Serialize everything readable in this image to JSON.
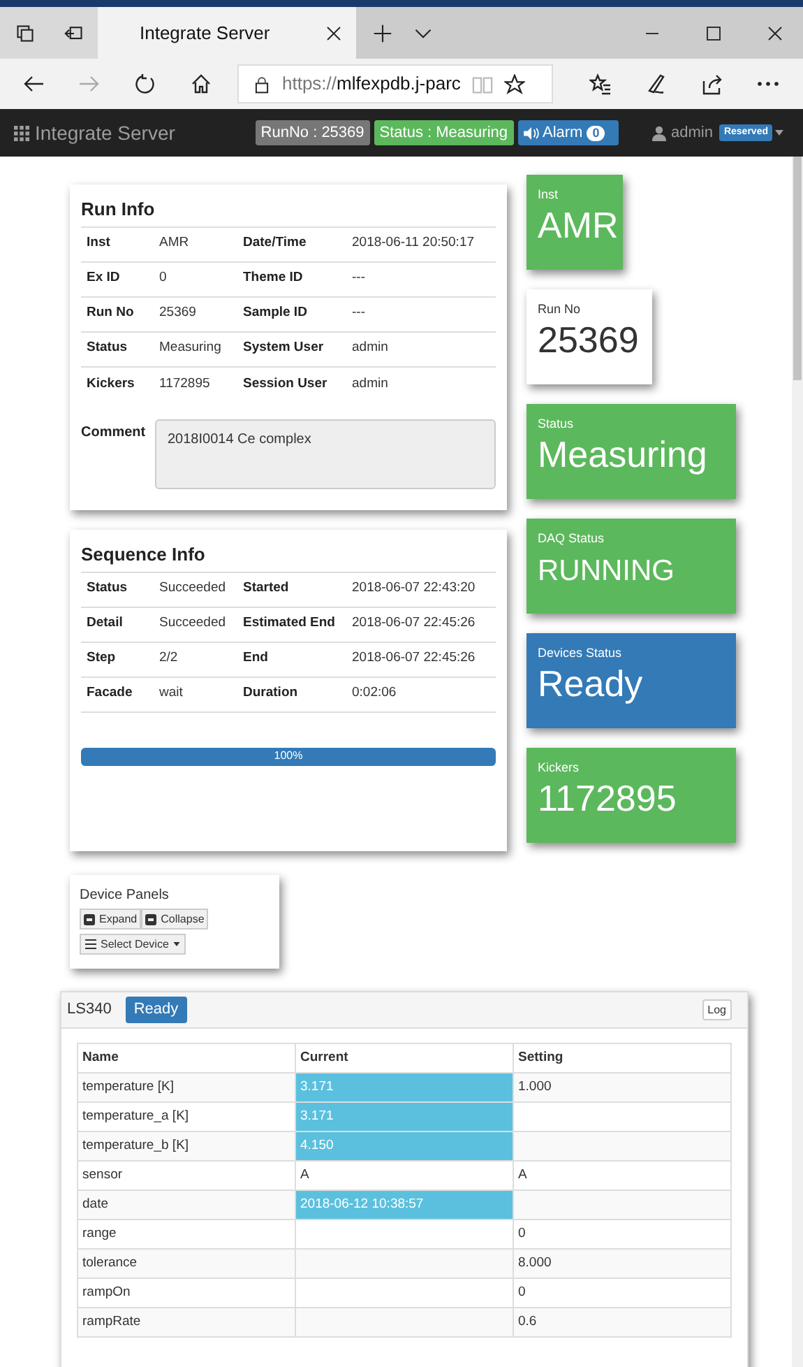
{
  "browser": {
    "tab_title": "Integrate Server",
    "tab_selected": true,
    "url_prefix": "https://",
    "url_host": "mlfexpdb.j-parc"
  },
  "navbar": {
    "brand": "Integrate Server",
    "run_badge": "RunNo : 25369",
    "status_badge": "Status : Measuring",
    "alarm_label": "Alarm",
    "alarm_count": "0",
    "user": "admin",
    "user_badge": "Reserved"
  },
  "run_info": {
    "title": "Run Info",
    "rows": [
      {
        "label": "Inst",
        "value": "AMR",
        "label2": "Date/Time",
        "value2": "2018-06-11 20:50:17"
      },
      {
        "label": "Ex ID",
        "value": "0",
        "label2": "Theme ID",
        "value2": "---"
      },
      {
        "label": "Run No",
        "value": "25369",
        "label2": "Sample ID",
        "value2": "---"
      },
      {
        "label": "Status",
        "value": "Measuring",
        "label2": "System User",
        "value2": "admin"
      },
      {
        "label": "Kickers",
        "value": "1172895",
        "label2": "Session User",
        "value2": "admin"
      }
    ],
    "comment_label": "Comment",
    "comment": "2018I0014 Ce complex"
  },
  "sequence_info": {
    "title": "Sequence Info",
    "rows": [
      {
        "label": "Status",
        "value": "Succeeded",
        "label2": "Started",
        "value2": "2018-06-07 22:43:20"
      },
      {
        "label": "Detail",
        "value": "Succeeded",
        "label2": "Estimated End",
        "value2": "2018-06-07 22:45:26"
      },
      {
        "label": "Step",
        "value": "2/2",
        "label2": "End",
        "value2": "2018-06-07 22:45:26"
      },
      {
        "label": "Facade",
        "value": "wait",
        "label2": "Duration",
        "value2": "0:02:06"
      }
    ],
    "progress": {
      "level": 1,
      "label": "100%"
    }
  },
  "tiles": [
    {
      "kind": "success",
      "label": "Inst",
      "value": "AMR"
    },
    {
      "kind": "default",
      "label": "Run No",
      "value": "25369"
    },
    {
      "kind": "success",
      "label": "Status",
      "value": "Measuring"
    },
    {
      "kind": "success",
      "label": "DAQ Status",
      "value": "RUNNING"
    },
    {
      "kind": "primary",
      "label": "Devices Status",
      "value": "Ready"
    },
    {
      "kind": "success",
      "label": "Kickers",
      "value": "1172895"
    }
  ],
  "device_panels": {
    "title": "Device Panels",
    "buttons": [
      "Expand",
      "Collapse"
    ],
    "select": "Select Device"
  },
  "device": {
    "name": "LS340",
    "status": "Ready",
    "log_button": "Log",
    "columns": [
      "Name",
      "Current",
      "Setting"
    ],
    "rows": [
      {
        "name": "temperature [K]",
        "current": "3.171",
        "highlighted": true,
        "setting": "1.000"
      },
      {
        "name": "temperature_a [K]",
        "current": "3.171",
        "highlighted": true
      },
      {
        "name": "temperature_b [K]",
        "current": "4.150",
        "highlighted": true
      },
      {
        "name": "sensor",
        "current": "A",
        "highlighted": false,
        "setting": "A"
      },
      {
        "name": "date",
        "current": "2018-06-12 10:38:57",
        "highlighted": true
      },
      {
        "name": "range",
        "highlighted": false,
        "setting": "0"
      },
      {
        "name": "tolerance",
        "highlighted": false,
        "setting": "8.000"
      },
      {
        "name": "rampOn",
        "highlighted": false,
        "setting": "0"
      },
      {
        "name": "rampRate",
        "highlighted": false,
        "setting": "0.6"
      }
    ]
  }
}
